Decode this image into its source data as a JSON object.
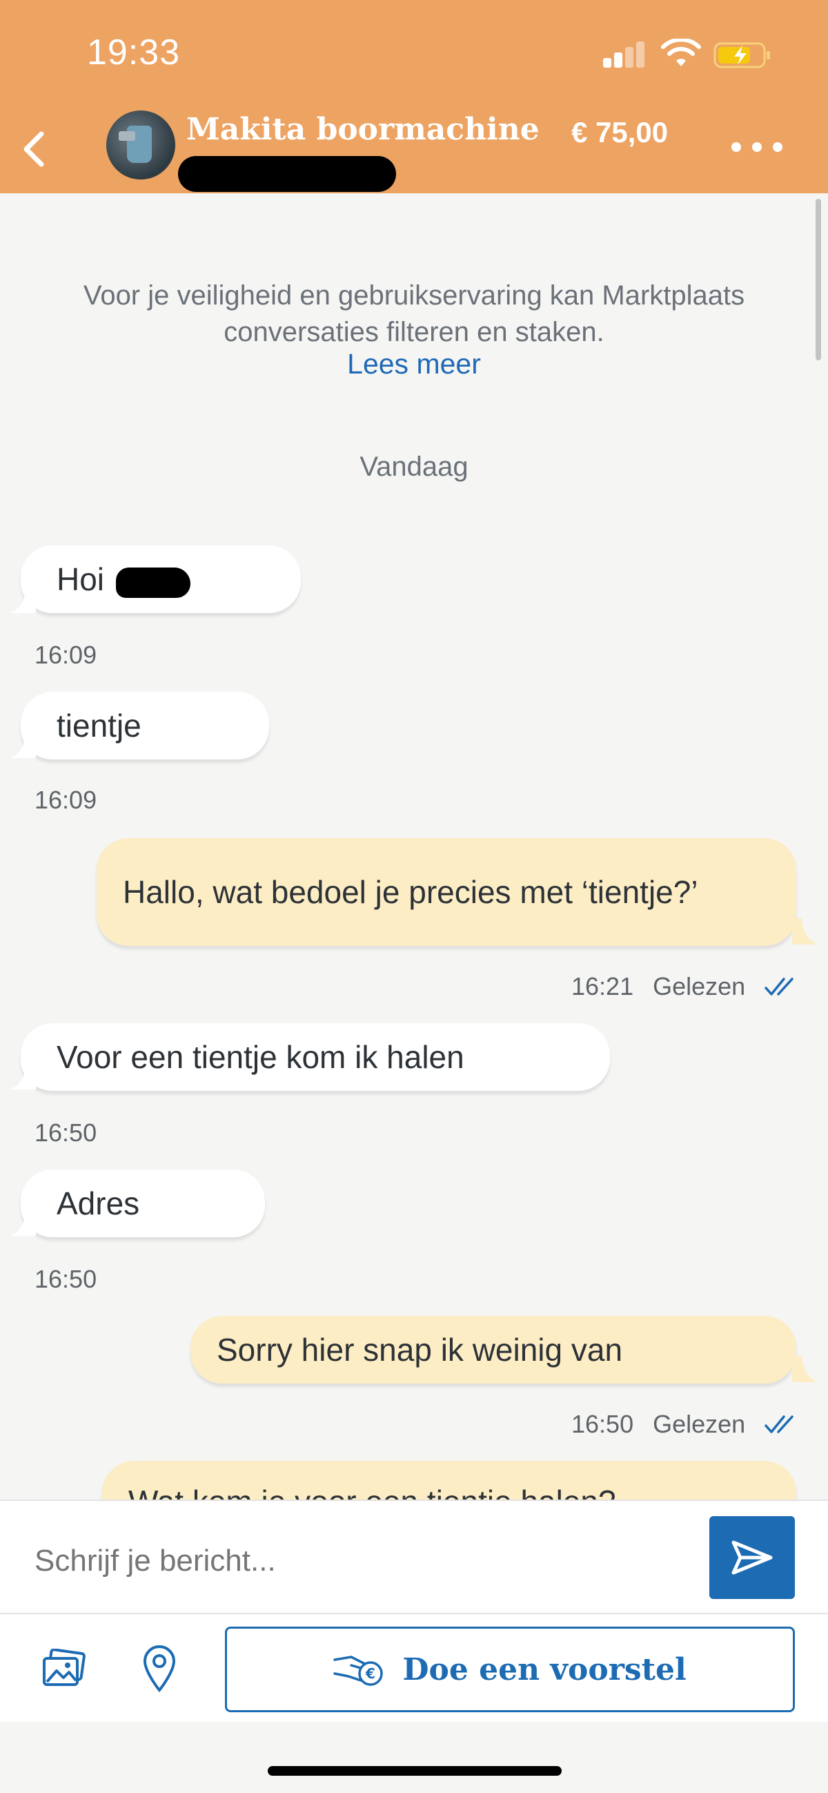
{
  "status_bar": {
    "time": "19:33"
  },
  "header": {
    "title": "Makita boormachine",
    "price": "€ 75,00",
    "back_icon": "chevron-left-icon",
    "more_icon": "more-dots-icon"
  },
  "notice": {
    "text": "Voor je veiligheid en gebruikservaring kan Marktplaats conversaties filteren en staken.",
    "link": "Lees meer"
  },
  "day_label": "Vandaag",
  "messages": [
    {
      "direction": "in",
      "text": "Hoi",
      "time": "16:09"
    },
    {
      "direction": "in",
      "text": "tientje",
      "time": "16:09"
    },
    {
      "direction": "out",
      "text": "Hallo, wat bedoel je precies met ‘tientje?’",
      "time": "16:21",
      "status": "Gelezen"
    },
    {
      "direction": "in",
      "text": "Voor een tientje kom ik halen",
      "time": "16:50"
    },
    {
      "direction": "in",
      "text": "Adres",
      "time": "16:50"
    },
    {
      "direction": "out",
      "text": "Sorry hier snap ik weinig van",
      "time": "16:50",
      "status": "Gelezen"
    },
    {
      "direction": "out",
      "text": "Wat kom je voor een tientje halen?",
      "partial": true
    }
  ],
  "composer": {
    "placeholder": "Schrijf je bericht...",
    "send_icon": "send-icon"
  },
  "toolbar": {
    "photo_icon": "photo-icon",
    "location_icon": "location-pin-icon",
    "offer_label": "Doe een voorstel",
    "offer_icon": "hand-euro-icon"
  },
  "colors": {
    "header_bg": "#eda362",
    "accent": "#1c6bb3",
    "outgoing_bubble": "#fdedc5",
    "incoming_bubble": "#ffffff",
    "background": "#f5f5f4"
  }
}
